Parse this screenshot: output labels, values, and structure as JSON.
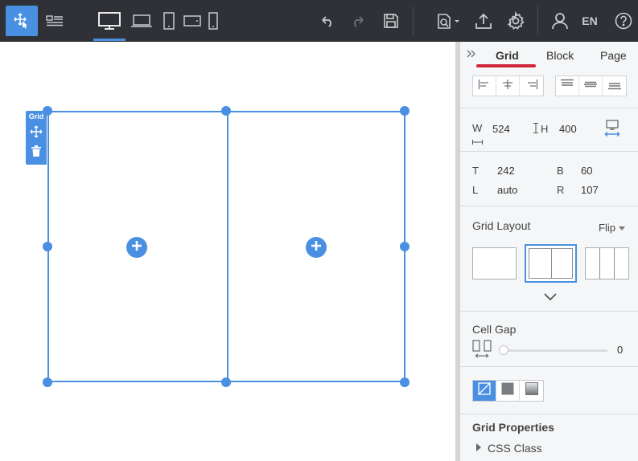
{
  "toolbar": {
    "lang": "EN",
    "icons": {
      "select": "move-cursor-icon",
      "layers": "layers-icon",
      "desktop": "desktop-icon",
      "laptop": "laptop-icon",
      "tablet": "tablet-portrait-icon",
      "tablet_landscape": "tablet-landscape-icon",
      "mobile": "mobile-icon",
      "undo": "undo-icon",
      "redo": "redo-icon",
      "save": "save-icon",
      "preview": "preview-icon",
      "publish": "upload-icon",
      "settings": "gear-icon",
      "account": "user-icon",
      "help": "help-icon"
    }
  },
  "canvas": {
    "grid_tag": "Grid"
  },
  "panel": {
    "tabs": [
      "Grid",
      "Block",
      "Page"
    ],
    "size": {
      "w_label": "W",
      "w_value": "524",
      "h_label": "H",
      "h_value": "400"
    },
    "position": {
      "t_label": "T",
      "t_value": "242",
      "b_label": "B",
      "b_value": "60",
      "l_label": "L",
      "l_value": "auto",
      "r_label": "R",
      "r_value": "107"
    },
    "grid_layout": {
      "title": "Grid Layout",
      "flip": "Flip",
      "selected_columns": 2,
      "options": [
        1,
        2,
        3
      ]
    },
    "cell_gap": {
      "title": "Cell Gap",
      "value": "0"
    },
    "grid_properties": {
      "title": "Grid Properties",
      "css_class": "CSS Class"
    }
  },
  "colors": {
    "accent": "#4a90e2",
    "toolbar": "#2f3136",
    "tab_underline": "#d0263a"
  }
}
